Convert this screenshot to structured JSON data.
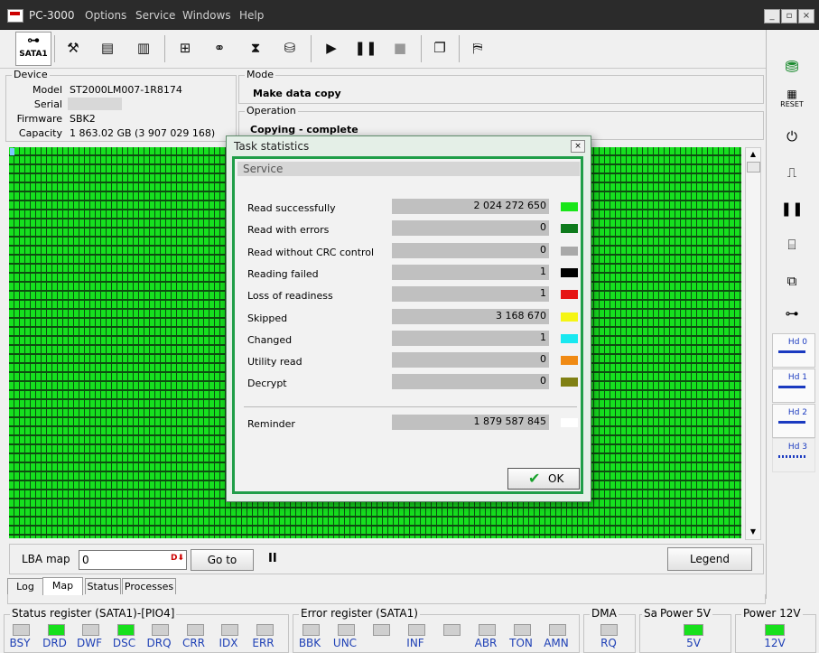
{
  "window": {
    "title": "PC-3000",
    "menu": [
      "Options",
      "Service",
      "Windows",
      "Help"
    ],
    "controls": [
      "_",
      "▫",
      "×"
    ]
  },
  "toolbar": {
    "sata_label": "SATA1"
  },
  "device": {
    "group_label": "Device",
    "model_label": "Model",
    "model": "ST2000LM007-1R8174",
    "serial_label": "Serial",
    "serial": "",
    "firmware_label": "Firmware",
    "firmware": "SBK2",
    "capacity_label": "Capacity",
    "capacity": "1 863.02 GB (3 907 029 168)"
  },
  "mode": {
    "group_label": "Mode",
    "value": "Make data copy"
  },
  "operation": {
    "group_label": "Operation",
    "value": "Copying - complete"
  },
  "map_controls": {
    "lba_label": "LBA map",
    "lba_value": "0",
    "goto_label": "Go to",
    "pause_glyph": "II",
    "legend_label": "Legend"
  },
  "tabs": [
    "Log",
    "Map",
    "Status",
    "Processes"
  ],
  "status_register": {
    "label": "Status register (SATA1)-[PIO4]",
    "bits": [
      {
        "name": "BSY",
        "on": false
      },
      {
        "name": "DRD",
        "on": true
      },
      {
        "name": "DWF",
        "on": false
      },
      {
        "name": "DSC",
        "on": true
      },
      {
        "name": "DRQ",
        "on": false
      },
      {
        "name": "CRR",
        "on": false
      },
      {
        "name": "IDX",
        "on": false
      },
      {
        "name": "ERR",
        "on": false
      }
    ]
  },
  "error_register": {
    "label": "Error register (SATA1)",
    "bits": [
      {
        "name": "BBK",
        "on": false
      },
      {
        "name": "UNC",
        "on": false
      },
      {
        "name": "",
        "on": false
      },
      {
        "name": "INF",
        "on": false
      },
      {
        "name": "",
        "on": false
      },
      {
        "name": "ABR",
        "on": false
      },
      {
        "name": "TON",
        "on": false
      },
      {
        "name": "AMN",
        "on": false
      }
    ]
  },
  "dma": {
    "label": "DMA",
    "bit": "RQ",
    "on": false
  },
  "power5": {
    "label": "Power 5V",
    "prefix": "Sa",
    "bit": "5V",
    "on": true
  },
  "power12": {
    "label": "Power 12V",
    "bit": "12V",
    "on": true
  },
  "sidebar": {
    "reset_label": "RESET",
    "hd": [
      "Hd 0",
      "Hd 1",
      "Hd 2",
      "Hd 3"
    ]
  },
  "dialog": {
    "title": "Task statistics",
    "close": "×",
    "section": "Service",
    "rows": [
      {
        "label": "Read successfully",
        "value": "2 024 272 650",
        "color": "#19e619"
      },
      {
        "label": "Read with errors",
        "value": "0",
        "color": "#0e7a1c"
      },
      {
        "label": "Read without CRC control",
        "value": "0",
        "color": "#a8a8a8"
      },
      {
        "label": "Reading failed",
        "value": "1",
        "color": "#000000"
      },
      {
        "label": "Loss of readiness",
        "value": "1",
        "color": "#e61414"
      },
      {
        "label": "Skipped",
        "value": "3 168 670",
        "color": "#f5f514"
      },
      {
        "label": "Changed",
        "value": "1",
        "color": "#19e8f0"
      },
      {
        "label": "Utility read",
        "value": "0",
        "color": "#f08a14"
      },
      {
        "label": "Decrypt",
        "value": "0",
        "color": "#808014"
      }
    ],
    "reminder": {
      "label": "Reminder",
      "value": "1 879 587 845",
      "color": "#ffffff"
    },
    "ok_label": "OK"
  }
}
